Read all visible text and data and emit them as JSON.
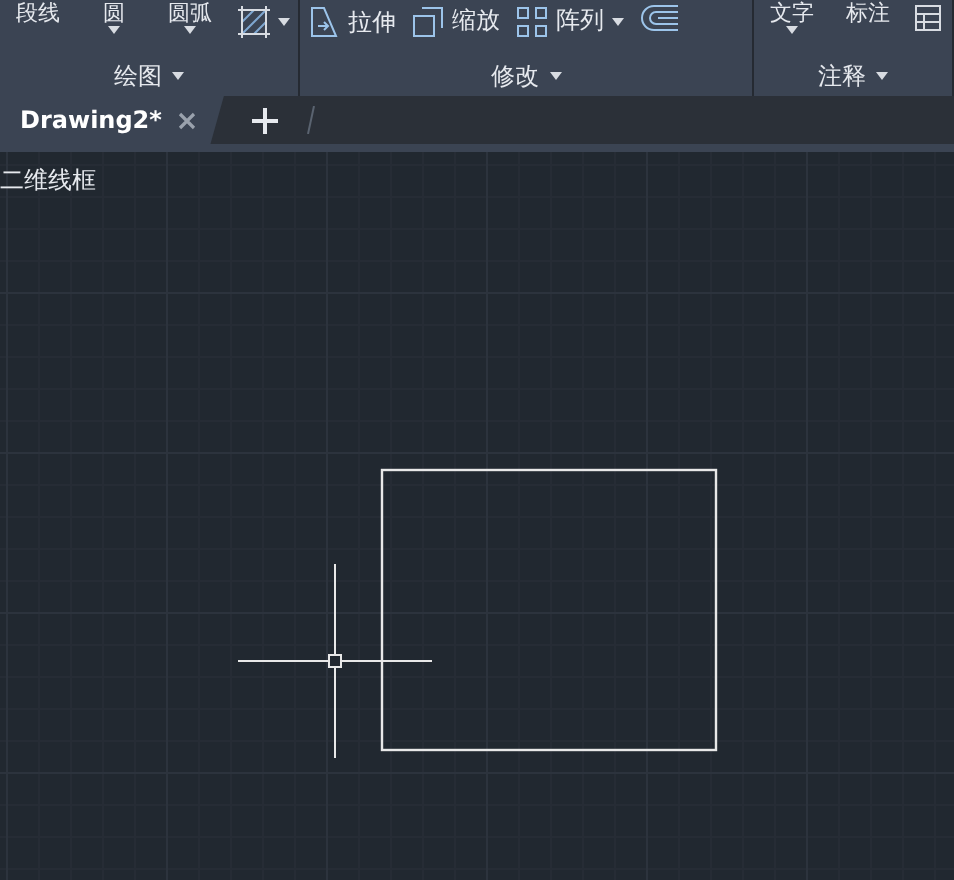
{
  "ribbon": {
    "panels": [
      {
        "label": "绘图",
        "tools": [
          {
            "kind": "large",
            "label": "段线",
            "dropdown": false
          },
          {
            "kind": "large",
            "label": "圆",
            "dropdown": true
          },
          {
            "kind": "large",
            "label": "圆弧",
            "dropdown": true
          },
          {
            "kind": "icon",
            "dropdown": true
          }
        ]
      },
      {
        "label": "修改",
        "tools": [
          {
            "kind": "small",
            "label": "拉伸",
            "dropdown": false
          },
          {
            "kind": "small",
            "label": "缩放",
            "dropdown": false
          },
          {
            "kind": "small",
            "label": "阵列",
            "dropdown": true
          },
          {
            "kind": "icon",
            "dropdown": false
          }
        ]
      },
      {
        "label": "注释",
        "tools": [
          {
            "kind": "large",
            "label": "文字",
            "dropdown": true
          },
          {
            "kind": "large",
            "label": "标注",
            "dropdown": false
          },
          {
            "kind": "icon",
            "dropdown": false
          }
        ]
      }
    ]
  },
  "tabs": [
    {
      "label": "Drawing2*",
      "selected": true
    }
  ],
  "viewport": {
    "visual_style": "二维线框"
  }
}
